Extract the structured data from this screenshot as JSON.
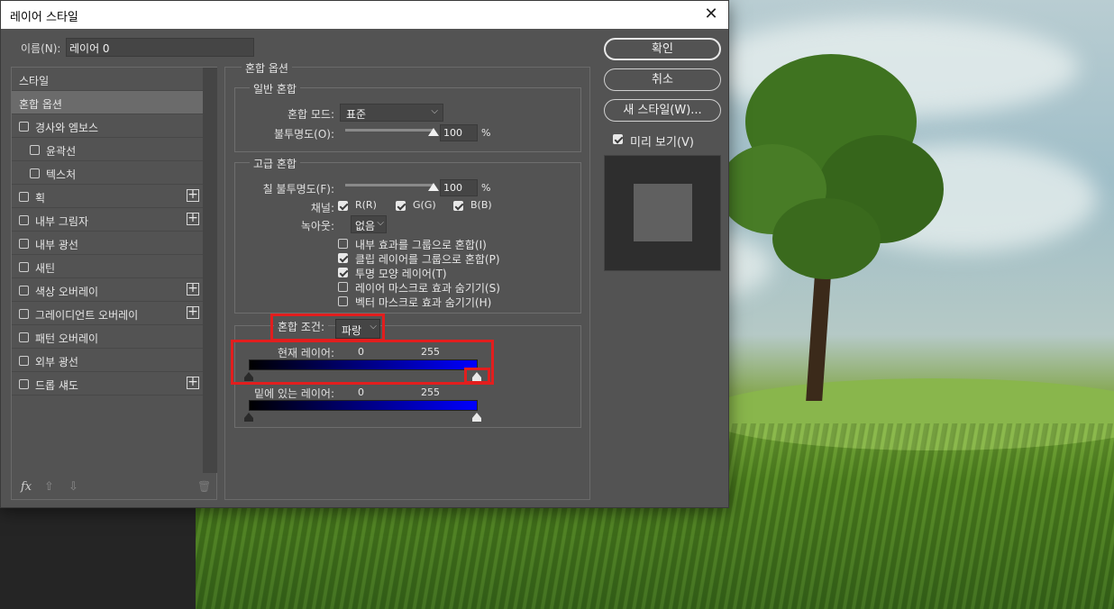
{
  "dialog": {
    "title": "레이어 스타일",
    "close_symbol": "✕"
  },
  "name_field": {
    "label": "이름(N):",
    "value": "레이어 0"
  },
  "style_list": {
    "items": [
      {
        "label": "스타일",
        "has_checkbox": false,
        "checked": false,
        "has_plus": false,
        "indent": false,
        "selected": false
      },
      {
        "label": "혼합 옵션",
        "has_checkbox": false,
        "checked": false,
        "has_plus": false,
        "indent": false,
        "selected": true
      },
      {
        "label": "경사와 엠보스",
        "has_checkbox": true,
        "checked": false,
        "has_plus": false,
        "indent": false,
        "selected": false
      },
      {
        "label": "윤곽선",
        "has_checkbox": true,
        "checked": false,
        "has_plus": false,
        "indent": true,
        "selected": false
      },
      {
        "label": "텍스처",
        "has_checkbox": true,
        "checked": false,
        "has_plus": false,
        "indent": true,
        "selected": false
      },
      {
        "label": "획",
        "has_checkbox": true,
        "checked": false,
        "has_plus": true,
        "indent": false,
        "selected": false
      },
      {
        "label": "내부 그림자",
        "has_checkbox": true,
        "checked": false,
        "has_plus": true,
        "indent": false,
        "selected": false
      },
      {
        "label": "내부 광선",
        "has_checkbox": true,
        "checked": false,
        "has_plus": false,
        "indent": false,
        "selected": false
      },
      {
        "label": "새틴",
        "has_checkbox": true,
        "checked": false,
        "has_plus": false,
        "indent": false,
        "selected": false
      },
      {
        "label": "색상 오버레이",
        "has_checkbox": true,
        "checked": false,
        "has_plus": true,
        "indent": false,
        "selected": false
      },
      {
        "label": "그레이디언트 오버레이",
        "has_checkbox": true,
        "checked": false,
        "has_plus": true,
        "indent": false,
        "selected": false
      },
      {
        "label": "패턴 오버레이",
        "has_checkbox": true,
        "checked": false,
        "has_plus": false,
        "indent": false,
        "selected": false
      },
      {
        "label": "외부 광선",
        "has_checkbox": true,
        "checked": false,
        "has_plus": false,
        "indent": false,
        "selected": false
      },
      {
        "label": "드롭 섀도",
        "has_checkbox": true,
        "checked": false,
        "has_plus": true,
        "indent": false,
        "selected": false
      }
    ],
    "footer": {
      "fx": "fx",
      "up": "⇧",
      "down": "⇩",
      "trash": "🗑"
    }
  },
  "blend_options": {
    "title": "혼합 옵션",
    "general": {
      "title": "일반 혼합",
      "mode_label": "혼합 모드:",
      "mode_value": "표준",
      "opacity_label": "불투명도(O):",
      "opacity_value": "100",
      "opacity_level": 1.0,
      "unit": "%"
    },
    "advanced": {
      "title": "고급 혼합",
      "fill_label": "칠 불투명도(F):",
      "fill_value": "100",
      "fill_level": 1.0,
      "unit": "%",
      "channels_label": "채널:",
      "channels": [
        {
          "label": "R(R)",
          "checked": true
        },
        {
          "label": "G(G)",
          "checked": true
        },
        {
          "label": "B(B)",
          "checked": true
        }
      ],
      "knockout_label": "녹아웃:",
      "knockout_value": "없음",
      "checkboxes": [
        {
          "label": "내부 효과를 그룹으로 혼합(I)",
          "checked": false
        },
        {
          "label": "클립 레이어를 그룹으로 혼합(P)",
          "checked": true
        },
        {
          "label": "투명 모양 레이어(T)",
          "checked": true
        },
        {
          "label": "레이어 마스크로 효과 숨기기(S)",
          "checked": false
        },
        {
          "label": "벡터 마스크로 효과 숨기기(H)",
          "checked": false
        }
      ]
    },
    "blend_if": {
      "label": "혼합 조건:",
      "channel": "파랑",
      "this_layer": {
        "label": "현재 레이어:",
        "min": "0",
        "max": "255"
      },
      "underlying_layer": {
        "label": "밑에 있는 레이어:",
        "min": "0",
        "max": "255"
      }
    }
  },
  "buttons": {
    "ok": "확인",
    "cancel": "취소",
    "new_style": "새 스타일(W)..."
  },
  "preview": {
    "label": "미리 보기(V)",
    "checked": true
  },
  "colors": {
    "accent_red": "#e21e1e",
    "blend_blue": "#0000ff"
  }
}
